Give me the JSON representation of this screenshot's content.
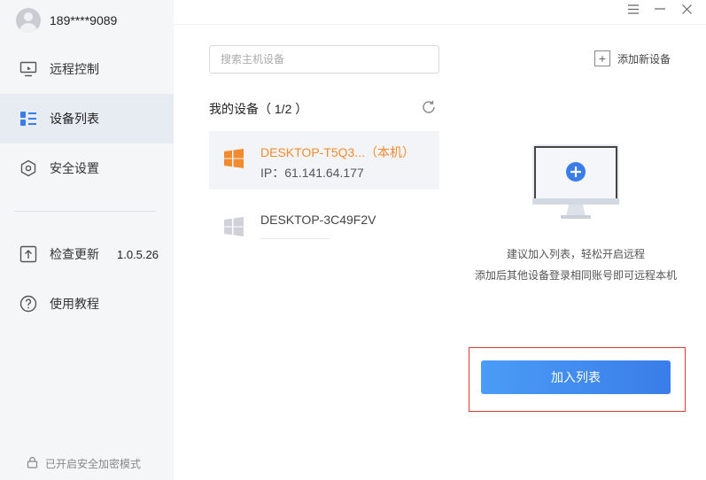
{
  "user": {
    "phone": "189****9089"
  },
  "sidebar": {
    "items": [
      {
        "label": "远程控制",
        "icon": "monitor-icon"
      },
      {
        "label": "设备列表",
        "icon": "device-list-icon",
        "active": true
      },
      {
        "label": "安全设置",
        "icon": "shield-hex-icon"
      },
      {
        "label": "检查更新",
        "icon": "upload-icon",
        "version": "1.0.5.26"
      },
      {
        "label": "使用教程",
        "icon": "help-icon"
      }
    ],
    "footer": "已开启安全加密模式"
  },
  "window": {
    "controls": [
      "menu-icon",
      "minimize-icon",
      "close-icon"
    ]
  },
  "search": {
    "placeholder": "搜索主机设备",
    "value": ""
  },
  "add_device": {
    "label": "添加新设备"
  },
  "device_section": {
    "title": "我的设备（ 1/2 ）"
  },
  "devices": [
    {
      "name": "DESKTOP-T5Q3...（本机）",
      "ip": "IP：61.141.64.177",
      "icon": "windows-icon",
      "status_color": "#f28a30"
    },
    {
      "name": "DESKTOP-3C49F2V",
      "icon": "windows-icon",
      "status_color": "#cfd3d9"
    }
  ],
  "empty_state": {
    "icon": "monitor-add-icon",
    "tip1": "建议加入列表，轻松开启远程",
    "tip2": "添加后其他设备登录相同账号即可远程本机"
  },
  "join_button": {
    "label": "加入列表"
  },
  "colors": {
    "accent": "#3a7de8",
    "local_device": "#f28a30",
    "highlight": "#e03a3a"
  }
}
